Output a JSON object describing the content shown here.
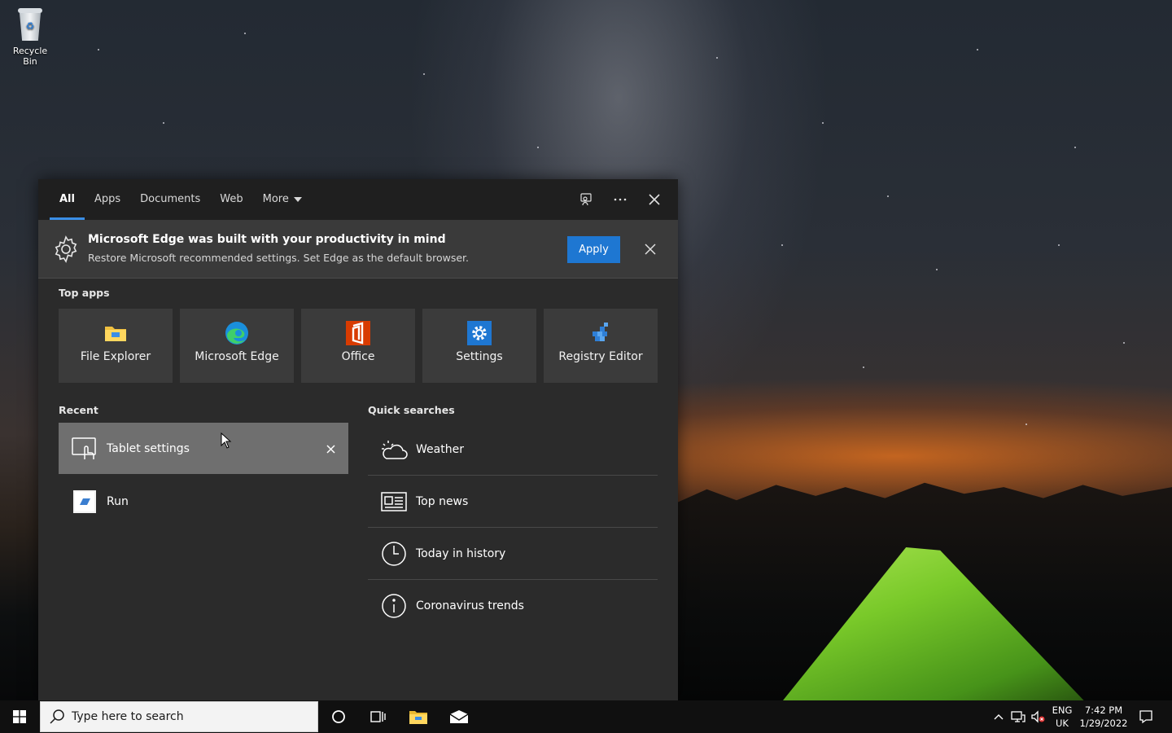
{
  "desktop": {
    "recycle_bin_label": "Recycle Bin"
  },
  "search_panel": {
    "tabs": [
      {
        "label": "All",
        "active": true
      },
      {
        "label": "Apps"
      },
      {
        "label": "Documents"
      },
      {
        "label": "Web"
      },
      {
        "label": "More"
      }
    ],
    "banner": {
      "title": "Microsoft Edge was built with your productivity in mind",
      "subtitle": "Restore Microsoft recommended settings. Set Edge as the default browser.",
      "apply_label": "Apply"
    },
    "top_apps_label": "Top apps",
    "top_apps": [
      {
        "name": "File Explorer",
        "icon": "folder-icon"
      },
      {
        "name": "Microsoft Edge",
        "icon": "edge-icon"
      },
      {
        "name": "Office",
        "icon": "office-icon"
      },
      {
        "name": "Settings",
        "icon": "gear-icon"
      },
      {
        "name": "Registry Editor",
        "icon": "registry-icon"
      }
    ],
    "recent_label": "Recent",
    "recent": [
      {
        "name": "Tablet settings",
        "icon": "tablet-icon"
      },
      {
        "name": "Run",
        "icon": "run-icon"
      }
    ],
    "quick_searches_label": "Quick searches",
    "quick_searches": [
      {
        "name": "Weather",
        "icon": "weather-icon"
      },
      {
        "name": "Top news",
        "icon": "news-icon"
      },
      {
        "name": "Today in history",
        "icon": "clock-icon"
      },
      {
        "name": "Coronavirus trends",
        "icon": "info-icon"
      }
    ]
  },
  "taskbar": {
    "search_placeholder": "Type here to search",
    "language": {
      "line1": "ENG",
      "line2": "UK"
    },
    "clock": {
      "time": "7:42 PM",
      "date": "1/29/2022"
    }
  },
  "colors": {
    "accent": "#3a8ee6",
    "apply_button": "#1e77d2",
    "panel_bg": "#2b2b2b",
    "taskbar_bg": "#101010"
  }
}
